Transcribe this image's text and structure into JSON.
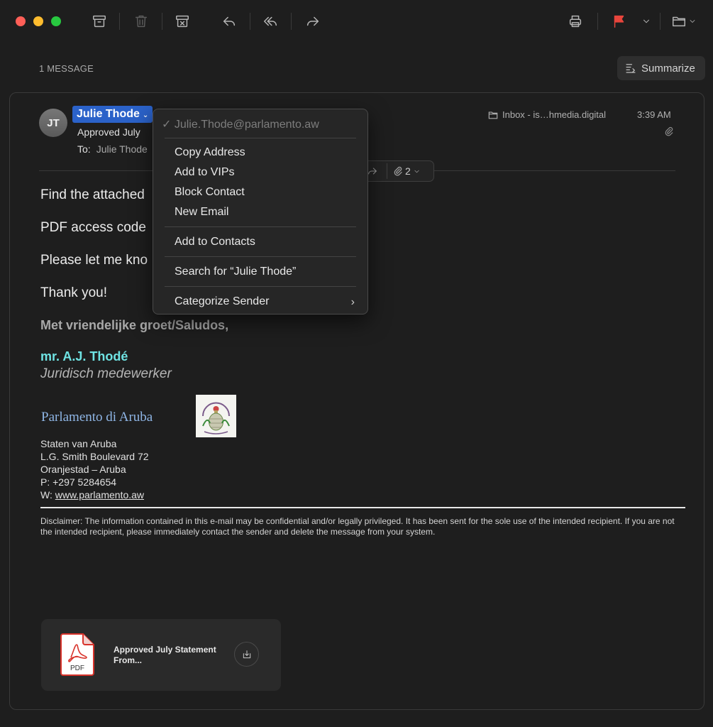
{
  "toolbar": {
    "icons": [
      "archive-icon",
      "trash-icon",
      "junk-icon",
      "reply-icon",
      "reply-all-icon",
      "forward-icon",
      "print-icon",
      "flag-icon",
      "flag-menu-chevron-icon",
      "move-folder-icon"
    ],
    "flag_color": "#e8453c"
  },
  "list": {
    "message_count": "1 MESSAGE",
    "summarize_label": "Summarize"
  },
  "message": {
    "avatar_initials": "JT",
    "sender_name": "Julie Thode",
    "subject": "Approved July",
    "to_label": "To:",
    "to_value": "Julie Thode",
    "mailbox": "Inbox - is…hmedia.digital",
    "time": "3:39 AM",
    "attachment_count": "2",
    "body": [
      "Find the attached",
      "PDF access code",
      "Please let me kno",
      "Thank you!"
    ],
    "greeting": "Met vriendelijke groet/Saludos,",
    "signature_name": "mr. A.J. Thodé",
    "signature_role": "Juridisch medewerker",
    "org_name": "Parlamento di Aruba",
    "address_lines": [
      "Staten van Aruba",
      "L.G. Smith Boulevard 72",
      "Oranjestad – Aruba",
      "P: +297 5284654"
    ],
    "web_label": "W: ",
    "web_link": "www.parlamento.aw",
    "disclaimer": "Disclaimer: The information contained in this e-mail may be confidential and/or legally privileged. It has been sent for the sole use of the intended recipient. If you are not the intended recipient, please immediately contact the sender and delete the message from your system."
  },
  "attachment": {
    "type_label": "PDF",
    "title": "Approved July Statement From..."
  },
  "context_menu": {
    "address": "✓ Julie.Thode@parlamento.aw",
    "items": {
      "copy_address": "Copy Address",
      "add_vips": "Add to VIPs",
      "block_contact": "Block Contact",
      "new_email": "New Email",
      "add_contacts": "Add to Contacts",
      "search": "Search for “Julie Thode”",
      "categorize": "Categorize Sender"
    }
  }
}
